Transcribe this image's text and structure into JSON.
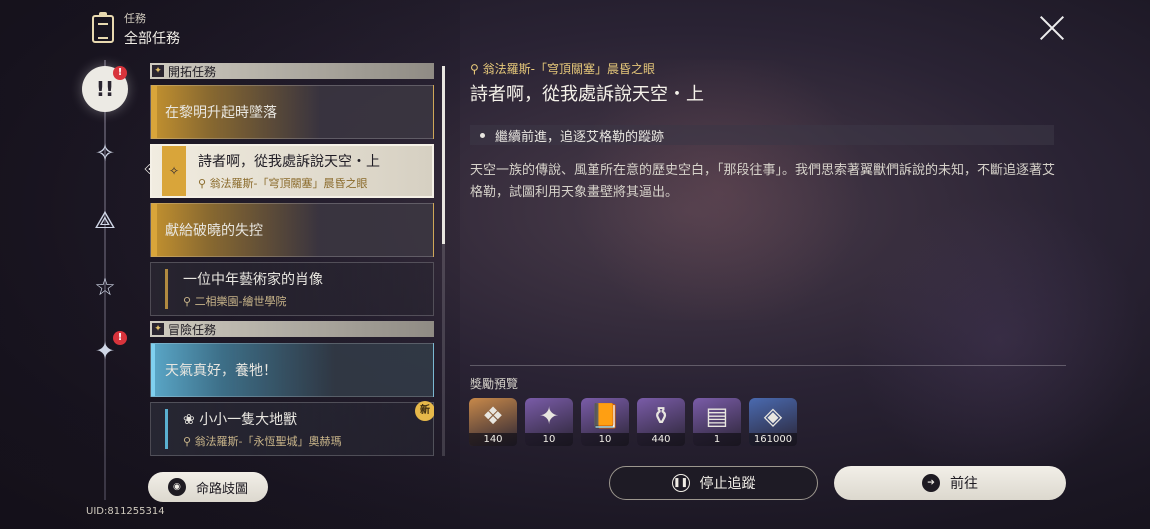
{
  "header": {
    "category": "任務",
    "title": "全部任務"
  },
  "sidebar": {
    "categories": [
      {
        "name": "all",
        "glyph": "!!",
        "badge": "!"
      },
      {
        "name": "trailblaze",
        "glyph": "✧"
      },
      {
        "name": "companion",
        "glyph": "⟁"
      },
      {
        "name": "adventure",
        "glyph": "☆"
      },
      {
        "name": "daily",
        "glyph": "✦",
        "badge": "!"
      }
    ]
  },
  "sections": [
    {
      "label": "開拓任務",
      "items": [
        {
          "name": "在黎明升起時墜落",
          "location": ""
        },
        {
          "name": "詩者啊，從我處訴說天空・上",
          "location": "翁法羅斯-「穹頂關塞」晨昏之眼",
          "selected": true
        },
        {
          "name": "獻給破曉的失控",
          "location": ""
        },
        {
          "name": "一位中年藝術家的肖像",
          "location": "二相樂園-繪世學院"
        }
      ]
    },
    {
      "label": "冒險任務",
      "items": [
        {
          "name": "天氣真好，養牠！",
          "location": ""
        },
        {
          "name": "小小一隻大地獸",
          "location": "翁法羅斯-「永恆聖城」奧赫瑪",
          "new_badge": "新"
        }
      ]
    }
  ],
  "detail": {
    "location": "翁法羅斯-「穹頂關塞」晨昏之眼",
    "title": "詩者啊，從我處訴說天空・上",
    "objective": "繼續前進，追逐艾格勒的蹤跡",
    "description": "天空一族的傳說、風堇所在意的歷史空白，「那段往事」。我們思索著翼獸們訴說的未知，不斷追逐著艾格勒，試圖利用天象畫壁將其逼出。",
    "rewards_title": "獎勵預覽",
    "rewards": [
      {
        "count": "140",
        "icon": "crystal-icon",
        "color": "#c8894a",
        "glyph": "❖"
      },
      {
        "count": "10",
        "icon": "special-pass-icon",
        "color": "#7a5ca8",
        "glyph": "✦"
      },
      {
        "count": "10",
        "icon": "book-icon",
        "color": "#7a5ca8",
        "glyph": "📙"
      },
      {
        "count": "440",
        "icon": "exp-potion-icon",
        "color": "#7a5ca8",
        "glyph": "⚱"
      },
      {
        "count": "1",
        "icon": "relic-box-icon",
        "color": "#7a5ca8",
        "glyph": "▤"
      },
      {
        "count": "161000",
        "icon": "credit-icon",
        "color": "#4a6ab0",
        "glyph": "◈"
      }
    ]
  },
  "buttons": {
    "stop": "停止追蹤",
    "go": "前往",
    "map": "命路歧圖"
  },
  "uid": "UID:811255314"
}
